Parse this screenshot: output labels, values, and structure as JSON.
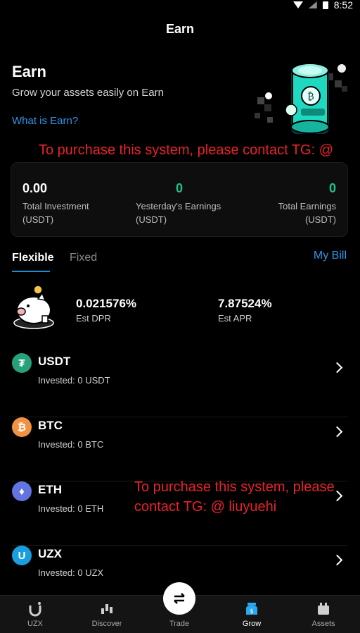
{
  "status_bar": {
    "time": "8:52"
  },
  "nav": {
    "title": "Earn"
  },
  "hero": {
    "title": "Earn",
    "subtitle": "Grow your assets easily on Earn",
    "link": "What is Earn?"
  },
  "watermarks": {
    "top": "To purchase this system, please contact TG: @ liuyuehi",
    "bottom": "To purchase this system, please contact TG: @ liuyuehi"
  },
  "summary": {
    "total_investment_value": "0.00",
    "total_investment_label": "Total Investment (USDT)",
    "yesterday_value": "0",
    "yesterday_label": "Yesterday's Earnings (USDT)",
    "total_earnings_value": "0",
    "total_earnings_label": "Total Earnings (USDT)"
  },
  "tabs": {
    "flexible": "Flexible",
    "fixed": "Fixed",
    "my_bill": "My Bill"
  },
  "rates": {
    "dpr_value": "0.021576%",
    "dpr_label": "Est DPR",
    "apr_value": "7.87524%",
    "apr_label": "Est APR"
  },
  "coins": [
    {
      "name": "USDT",
      "invested": "Invested: 0 USDT",
      "icon": "tether-icon",
      "color": "#26a17b",
      "glyph": "₮"
    },
    {
      "name": "BTC",
      "invested": "Invested: 0 BTC",
      "icon": "bitcoin-icon",
      "color": "#f09242",
      "glyph": "₿"
    },
    {
      "name": "ETH",
      "invested": "Invested: 0 ETH",
      "icon": "ethereum-icon",
      "color": "#6274e0",
      "glyph": "♦"
    },
    {
      "name": "UZX",
      "invested": "Invested: 0 UZX",
      "icon": "uzx-icon",
      "color": "#1b9ee0",
      "glyph": "U"
    }
  ],
  "bottom_nav": [
    {
      "label": "UZX",
      "icon": "uzx-logo-icon"
    },
    {
      "label": "Discover",
      "icon": "discover-icon"
    },
    {
      "label": "Trade",
      "icon": "swap-icon"
    },
    {
      "label": "Grow",
      "icon": "grow-icon",
      "active": true
    },
    {
      "label": "Assets",
      "icon": "wallet-icon"
    }
  ]
}
